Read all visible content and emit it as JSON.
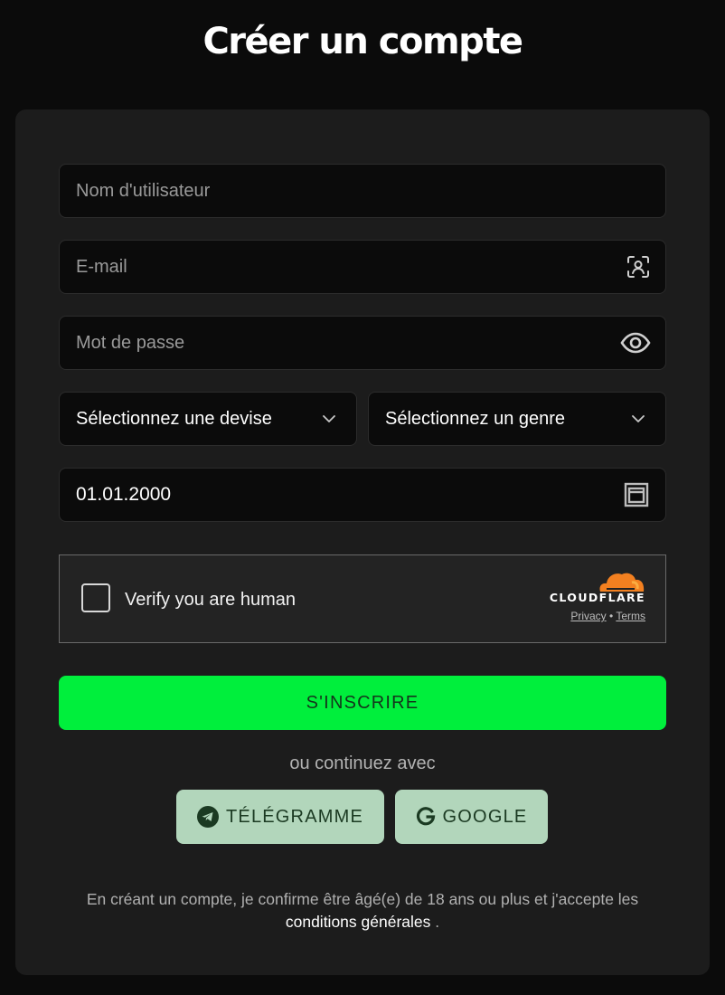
{
  "header": {
    "title": "Créer un compte"
  },
  "form": {
    "username_placeholder": "Nom d'utilisateur",
    "email_placeholder": "E-mail",
    "password_placeholder": "Mot de passe",
    "currency_select": "Sélectionnez une devise",
    "gender_select": "Sélectionnez un genre",
    "birthdate": "01.01.2000"
  },
  "captcha": {
    "label": "Verify you are human",
    "brand": "CLOUDFLARE",
    "privacy": "Privacy",
    "separator": "•",
    "terms": "Terms",
    "brand_color": "#f38020"
  },
  "actions": {
    "submit_label": "S'INSCRIRE",
    "or_text": "ou continuez avec",
    "telegram_label": "TÉLÉGRAMME",
    "google_label": "GOOGLE"
  },
  "legal": {
    "text": "En créant un compte, je confirme être âgé(e) de 18 ans ou plus et j'accepte les",
    "link": "conditions générales",
    "end": "."
  },
  "colors": {
    "accent": "#00ef3c",
    "social_bg": "#b2d6bb",
    "card_bg": "#1c1c1c",
    "page_bg": "#0b0b0b"
  },
  "icons": [
    "contact-card-icon",
    "eye-icon",
    "chevron-down-icon",
    "calendar-icon",
    "cloudflare-logo",
    "telegram-icon",
    "google-icon"
  ]
}
